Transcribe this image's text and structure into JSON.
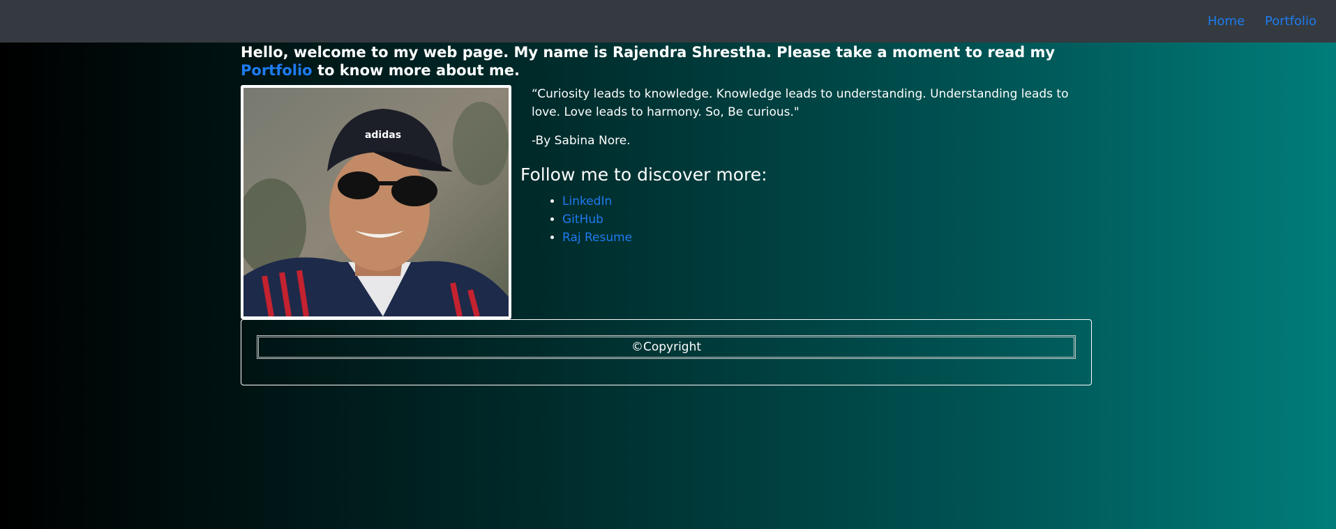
{
  "nav": {
    "home_label": "Home",
    "portfolio_label": "Portfolio"
  },
  "intro": {
    "text_before": "Hello, welcome to my web page. My name is Rajendra Shrestha. Please take a moment to read my ",
    "link_label": "Portfolio",
    "text_after": " to know more about me."
  },
  "quote": {
    "text": "“Curiosity leads to knowledge. Knowledge leads to understanding. Understanding leads to love. Love leads to harmony. So, Be curious.\"",
    "author": "-By Sabina Nore."
  },
  "follow": {
    "heading": "Follow me to discover more:",
    "links": [
      "LinkedIn",
      "GitHub",
      "Raj Resume"
    ]
  },
  "footer": {
    "copyright": "©Copyright"
  },
  "colors": {
    "navbar_bg": "#343a40",
    "link": "#1e7bf0",
    "gradient_start": "#000000",
    "gradient_end": "#007d7a"
  }
}
